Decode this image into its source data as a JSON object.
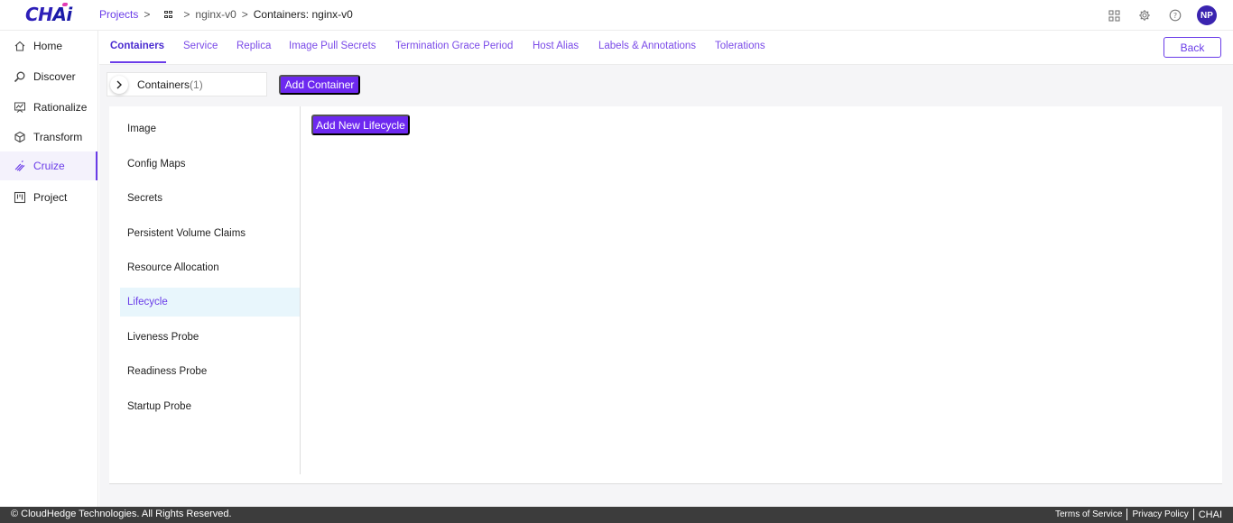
{
  "app": {
    "logo": "CHAi",
    "logo_main": "CH",
    "logo_accent": "Ai"
  },
  "breadcrumb": {
    "projects": "Projects",
    "sep": ">",
    "project": "nginx-v0",
    "current": "Containers: nginx-v0"
  },
  "header": {
    "user_initials": "NP"
  },
  "sidebar": {
    "items": [
      {
        "label": "Home",
        "icon": "home-icon"
      },
      {
        "label": "Discover",
        "icon": "discover-icon"
      },
      {
        "label": "Rationalize",
        "icon": "rationalize-icon"
      },
      {
        "label": "Transform",
        "icon": "transform-icon"
      },
      {
        "label": "Cruize",
        "icon": "cruize-icon",
        "active": true
      },
      {
        "label": "Project",
        "icon": "project-icon"
      }
    ]
  },
  "tabs": {
    "items": [
      "Containers",
      "Service",
      "Replica",
      "Image Pull Secrets",
      "Termination Grace Period",
      "Host Alias",
      "Labels & Annotations",
      "Tolerations"
    ],
    "active": "Containers",
    "back_label": "Back"
  },
  "containers": {
    "label": "Containers",
    "count": "(1)",
    "add_label": "Add Container"
  },
  "menu": {
    "items": [
      "Image",
      "Config Maps",
      "Secrets",
      "Persistent Volume Claims",
      "Resource Allocation",
      "Lifecycle",
      "Liveness Probe",
      "Readiness Probe",
      "Startup Probe"
    ],
    "active": "Lifecycle"
  },
  "lifecycle": {
    "add_label": "Add New Lifecycle"
  },
  "footer": {
    "copyright": "© CloudHedge Technologies. All Rights Reserved.",
    "terms": "Terms of Service",
    "privacy": "Privacy Policy",
    "brand": "CHAI"
  },
  "colors": {
    "accent": "#6d28f0",
    "active_menu_bg": "#e8f6fc",
    "footer_bg": "#3c3c3c"
  }
}
